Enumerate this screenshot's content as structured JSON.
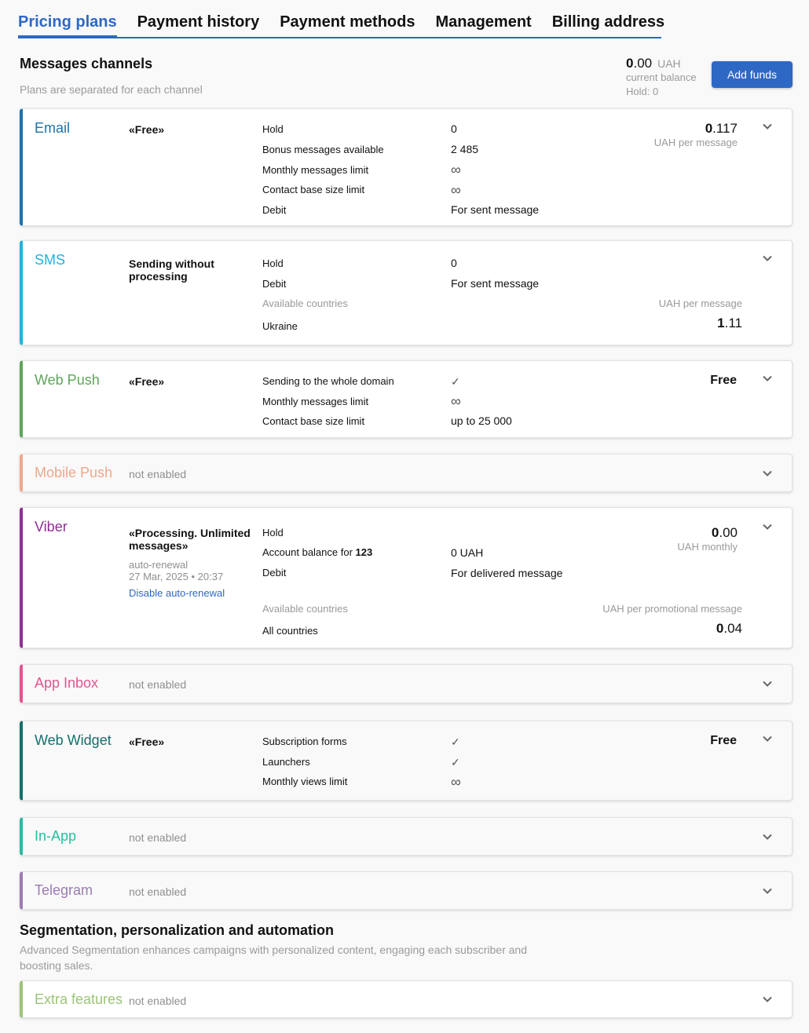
{
  "tabs": [
    "Pricing plans",
    "Payment history",
    "Payment methods",
    "Management",
    "Billing address"
  ],
  "active_tab": "Pricing plans",
  "header": {
    "title": "Messages channels",
    "subtitle": "Plans are separated for each channel",
    "balance_int": "0",
    "balance_dec": ".00",
    "currency": "UAH",
    "balance_label": "current balance",
    "hold": "Hold: 0",
    "add_funds": "Add funds"
  },
  "colors": {
    "accent": "#2d68c4",
    "email": "#1d72aa",
    "sms": "#1fb3e0",
    "webpush": "#5fa55a",
    "mobilepush": "#f0a78a",
    "viber": "#8e2f93",
    "appinbox": "#e5538f",
    "webwidget": "#13706b",
    "inapp": "#2bbba0",
    "telegram": "#9c7bb2",
    "extra": "#9cc47a"
  },
  "not_enabled": "not enabled",
  "email": {
    "name": "Email",
    "plan": "«Free»",
    "rows": [
      {
        "label": "Hold",
        "value": "0"
      },
      {
        "label": "Bonus messages available",
        "value": "2 485"
      },
      {
        "label": "Monthly messages limit",
        "value": "∞"
      },
      {
        "label": "Contact base size limit",
        "value": "∞"
      },
      {
        "label": "Debit",
        "value": "For sent message"
      }
    ],
    "price_int": "0",
    "price_dec": ".117",
    "price_unit": "UAH per message"
  },
  "sms": {
    "name": "SMS",
    "plan": "Sending without processing",
    "rows": [
      {
        "label": "Hold",
        "value": "0"
      },
      {
        "label": "Debit",
        "value": "For sent message"
      }
    ],
    "countries_label": "Available countries",
    "price_unit": "UAH per message",
    "country": "Ukraine",
    "price_int": "1",
    "price_dec": ".11"
  },
  "webpush": {
    "name": "Web Push",
    "plan": "«Free»",
    "rows": [
      {
        "label": "Sending to the whole domain",
        "value": "✓"
      },
      {
        "label": "Monthly messages limit",
        "value": "∞"
      },
      {
        "label": "Contact base size limit",
        "value": "up to 25 000"
      }
    ],
    "price": "Free"
  },
  "mobilepush": {
    "name": "Mobile Push"
  },
  "viber": {
    "name": "Viber",
    "plan": "«Processing. Unlimited messages»",
    "auto_renewal": "auto-renewal",
    "renewal_date": "27 Mar, 2025 • 20:37",
    "disable_link": "Disable auto-renewal",
    "rows": [
      {
        "label": "Hold",
        "value": ""
      },
      {
        "label": "Account balance for",
        "label_bold": "123",
        "value": "0 UAH"
      },
      {
        "label": "Debit",
        "value": "For delivered message"
      }
    ],
    "price_int": "0",
    "price_dec": ".00",
    "price_unit": "UAH monthly",
    "countries_label": "Available countries",
    "promo_unit": "UAH per promotional message",
    "country": "All countries",
    "promo_int": "0",
    "promo_dec": ".04"
  },
  "appinbox": {
    "name": "App Inbox"
  },
  "webwidget": {
    "name": "Web Widget",
    "plan": "«Free»",
    "rows": [
      {
        "label": "Subscription forms",
        "value": "✓"
      },
      {
        "label": "Launchers",
        "value": "✓"
      },
      {
        "label": "Monthly views limit",
        "value": "∞"
      }
    ],
    "price": "Free"
  },
  "inapp": {
    "name": "In-App"
  },
  "telegram": {
    "name": "Telegram"
  },
  "segmentation": {
    "title": "Segmentation, personalization and automation",
    "description": "Advanced Segmentation enhances campaigns with personalized content, engaging each subscriber and boosting sales.",
    "extra": {
      "name": "Extra features"
    }
  }
}
